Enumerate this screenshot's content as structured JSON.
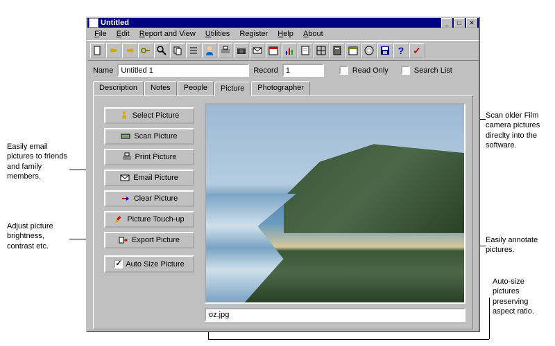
{
  "window": {
    "title": "Untitled"
  },
  "menu": {
    "file": "File",
    "edit": "Edit",
    "report": "Report and View",
    "utilities": "Utilities",
    "register": "Register",
    "help": "Help",
    "about": "About"
  },
  "form": {
    "name_label": "Name",
    "name_value": "Untitled 1",
    "record_label": "Record",
    "record_value": "1",
    "readonly_label": "Read Only",
    "searchlist_label": "Search List"
  },
  "tabs": {
    "description": "Description",
    "notes": "Notes",
    "people": "People",
    "picture": "Picture",
    "photographer": "Photographer"
  },
  "buttons": {
    "select": "Select Picture",
    "scan": "Scan Picture",
    "print": "Print Picture",
    "email": "Email Picture",
    "clear": "Clear Picture",
    "touchup": "Picture Touch-up",
    "export": "Export Picture",
    "autosize": "Auto Size Picture"
  },
  "picture": {
    "filename": "oz.jpg"
  },
  "annotations": {
    "email": "Easily email pictures to friends and family members.",
    "adjust": "Adjust picture brightness, contrast etc.",
    "scan": "Scan older Film camera pictures direclty into the software.",
    "annotate": "Easily annotate pictures.",
    "autosize": "Auto-size pictures preserving aspect ratio."
  }
}
